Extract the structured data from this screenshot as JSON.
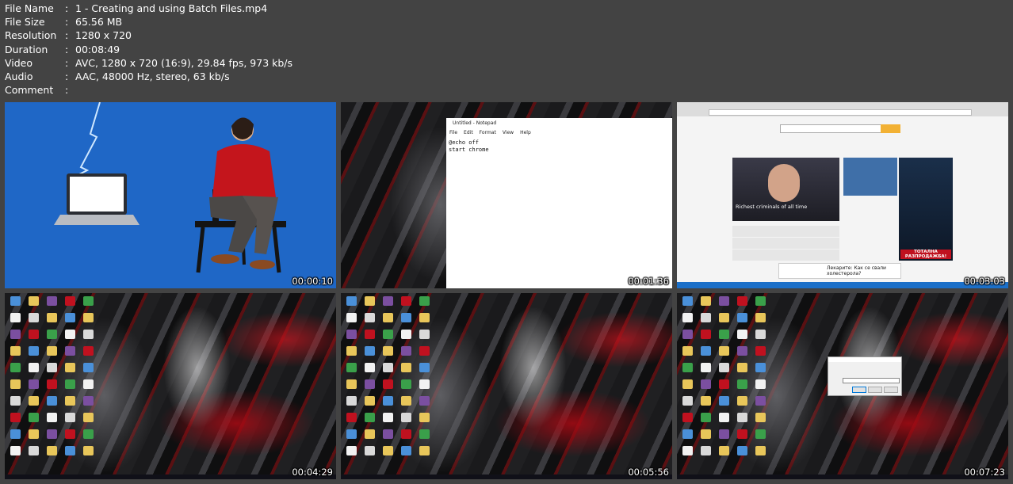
{
  "info": {
    "rows": [
      {
        "key": "File Name",
        "value": "1 - Creating and using Batch Files.mp4"
      },
      {
        "key": "File Size",
        "value": "65.56 MB"
      },
      {
        "key": "Resolution",
        "value": "1280 x 720"
      },
      {
        "key": "Duration",
        "value": "00:08:49"
      },
      {
        "key": "Video",
        "value": "AVC, 1280 x 720 (16:9), 29.84 fps, 973 kb/s"
      },
      {
        "key": "Audio",
        "value": "AAC, 48000 Hz, stereo, 63 kb/s"
      },
      {
        "key": "Comment",
        "value": ""
      }
    ]
  },
  "thumbnails": [
    {
      "timestamp": "00:00:10"
    },
    {
      "timestamp": "00:01:36",
      "notepad": {
        "title": "Untitled - Notepad",
        "menu": [
          "File",
          "Edit",
          "Format",
          "View",
          "Help"
        ],
        "lines": [
          "@echo off",
          "start chrome"
        ]
      }
    },
    {
      "timestamp": "00:03:03",
      "news": {
        "headline": "Richest criminals of all time",
        "side": "Лекарите: Как се свали холестерола?",
        "ad": "ТОТАЛНА РАЗПРОДАЖБА!"
      }
    },
    {
      "timestamp": "00:04:29"
    },
    {
      "timestamp": "00:05:56"
    },
    {
      "timestamp": "00:07:23"
    }
  ],
  "colors": {
    "background": "#434343",
    "thumb1_bg": "#1f67c6",
    "accent_red": "#c0111f"
  }
}
